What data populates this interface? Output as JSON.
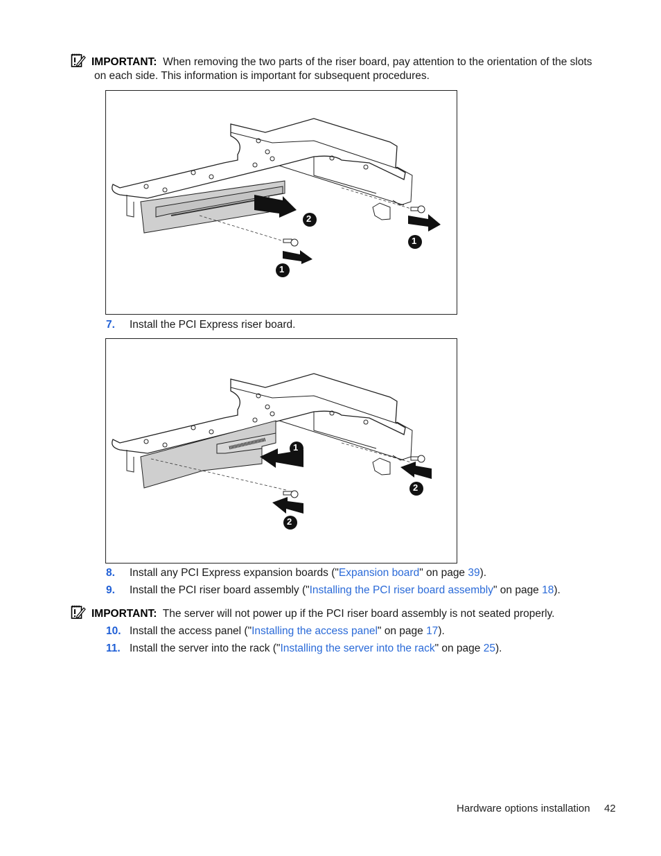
{
  "important_1": {
    "label": "IMPORTANT:",
    "line1": "When removing the two parts of the riser board, pay attention to the orientation of the slots",
    "line2": "on each side. This information is important for subsequent procedures."
  },
  "figure_1": {
    "callouts": [
      "1",
      "2",
      "1"
    ]
  },
  "step_7": {
    "number": "7.",
    "text": "Install the PCI Express riser board."
  },
  "figure_2": {
    "callouts": [
      "1",
      "2",
      "2"
    ]
  },
  "step_8": {
    "number": "8.",
    "prefix": "Install any PCI Express expansion boards (\"",
    "link": "Expansion board",
    "middle": "\" on page ",
    "page": "39",
    "suffix": ")."
  },
  "step_9": {
    "number": "9.",
    "prefix": "Install the PCI riser board assembly (\"",
    "link": "Installing the PCI riser board assembly",
    "middle": "\" on page ",
    "page": "18",
    "suffix": ")."
  },
  "important_2": {
    "label": "IMPORTANT:",
    "text": "The server will not power up if the PCI riser board assembly is not seated properly."
  },
  "step_10": {
    "number": "10.",
    "prefix": "Install the access panel (\"",
    "link": "Installing the access panel",
    "middle": "\" on page ",
    "page": "17",
    "suffix": ")."
  },
  "step_11": {
    "number": "11.",
    "prefix": "Install the server into the rack (\"",
    "link": "Installing the server into the rack",
    "middle": "\" on page ",
    "page": "25",
    "suffix": ")."
  },
  "footer": {
    "section": "Hardware options installation",
    "page_number": "42"
  },
  "colors": {
    "link": "#2a6ad8",
    "step_number": "#1f5fd6",
    "board_fill": "#cfcfcf"
  }
}
